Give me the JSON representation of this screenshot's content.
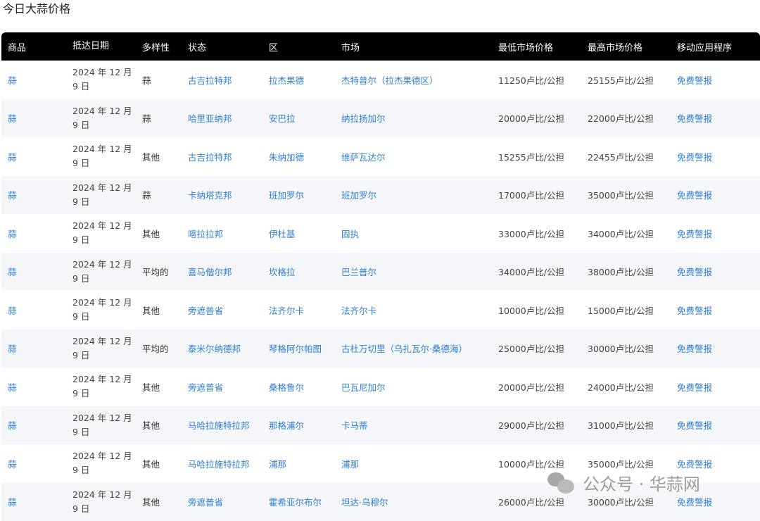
{
  "page": {
    "title": "今日大蒜价格"
  },
  "table": {
    "headers": [
      "商品",
      "抵达日期",
      "多样性",
      "状态",
      "区",
      "市场",
      "最低市场价格",
      "最高市场价格",
      "移动应用程序"
    ],
    "rows": [
      {
        "commodity": "蒜",
        "date_line1": "2024 年 12 月",
        "date_line2": "9 日",
        "variety": "蒜",
        "state": "古吉拉特邦",
        "district": "拉杰果德",
        "market": "杰特普尔（拉杰果德区）",
        "min": "11250卢比/公担",
        "max": "25155卢比/公担",
        "app": "免费警报"
      },
      {
        "commodity": "蒜",
        "date_line1": "2024 年 12 月",
        "date_line2": "9 日",
        "variety": "蒜",
        "state": "哈里亚纳邦",
        "district": "安巴拉",
        "market": "纳拉扬加尔",
        "min": "20000卢比/公担",
        "max": "22000卢比/公担",
        "app": "免费警报"
      },
      {
        "commodity": "蒜",
        "date_line1": "2024 年 12 月",
        "date_line2": "9 日",
        "variety": "其他",
        "state": "古吉拉特邦",
        "district": "朱纳加德",
        "market": "维萨瓦达尔",
        "min": "15255卢比/公担",
        "max": "22455卢比/公担",
        "app": "免费警报"
      },
      {
        "commodity": "蒜",
        "date_line1": "2024 年 12 月",
        "date_line2": "9 日",
        "variety": "蒜",
        "state": "卡纳塔克邦",
        "district": "班加罗尔",
        "market": "班加罗尔",
        "min": "17000卢比/公担",
        "max": "35000卢比/公担",
        "app": "免费警报"
      },
      {
        "commodity": "蒜",
        "date_line1": "2024 年 12 月",
        "date_line2": "9 日",
        "variety": "其他",
        "state": "喀拉拉邦",
        "district": "伊杜基",
        "market": "固执",
        "min": "33000卢比/公担",
        "max": "34000卢比/公担",
        "app": "免费警报"
      },
      {
        "commodity": "蒜",
        "date_line1": "2024 年 12 月",
        "date_line2": "9 日",
        "variety": "平均的",
        "state": "喜马偕尔邦",
        "district": "坎格拉",
        "market": "巴兰普尔",
        "min": "34000卢比/公担",
        "max": "38000卢比/公担",
        "app": "免费警报"
      },
      {
        "commodity": "蒜",
        "date_line1": "2024 年 12 月",
        "date_line2": "9 日",
        "variety": "其他",
        "state": "旁遮普省",
        "district": "法齐尔卡",
        "market": "法齐尔卡",
        "min": "10000卢比/公担",
        "max": "15000卢比/公担",
        "app": "免费警报"
      },
      {
        "commodity": "蒜",
        "date_line1": "2024 年 12 月",
        "date_line2": "9 日",
        "variety": "平均的",
        "state": "泰米尔纳德邦",
        "district": "琴格阿尔帕图",
        "market": "古杜万切里（乌扎瓦尔·桑德海）",
        "min": "25000卢比/公担",
        "max": "30000卢比/公担",
        "app": "免费警报"
      },
      {
        "commodity": "蒜",
        "date_line1": "2024 年 12 月",
        "date_line2": "9 日",
        "variety": "其他",
        "state": "旁遮普省",
        "district": "桑格鲁尔",
        "market": "巴瓦尼加尔",
        "min": "20000卢比/公担",
        "max": "24000卢比/公担",
        "app": "免费警报"
      },
      {
        "commodity": "蒜",
        "date_line1": "2024 年 12 月",
        "date_line2": "9 日",
        "variety": "其他",
        "state": "马哈拉施特拉邦",
        "district": "那格浦尔",
        "market": "卡马蒂",
        "min": "29000卢比/公担",
        "max": "31000卢比/公担",
        "app": "免费警报"
      },
      {
        "commodity": "蒜",
        "date_line1": "2024 年 12 月",
        "date_line2": "9 日",
        "variety": "其他",
        "state": "马哈拉施特拉邦",
        "district": "浦那",
        "market": "浦那",
        "min": "10000卢比/公担",
        "max": "35000卢比/公担",
        "app": "免费警报"
      },
      {
        "commodity": "蒜",
        "date_line1": "2024 年 12 月",
        "date_line2": "9 日",
        "variety": "其他",
        "state": "旁遮普省",
        "district": "霍希亚尔布尔",
        "market": "坦达·乌穆尔",
        "min": "26000卢比/公担",
        "max": "30000卢比/公担",
        "app": "免费警报"
      }
    ]
  },
  "watermark": {
    "text": "公众号 · 华蒜网"
  },
  "colors": {
    "link": "#2f7dd3",
    "header_bg": "#000000",
    "alt_row": "#f4f6f9"
  }
}
